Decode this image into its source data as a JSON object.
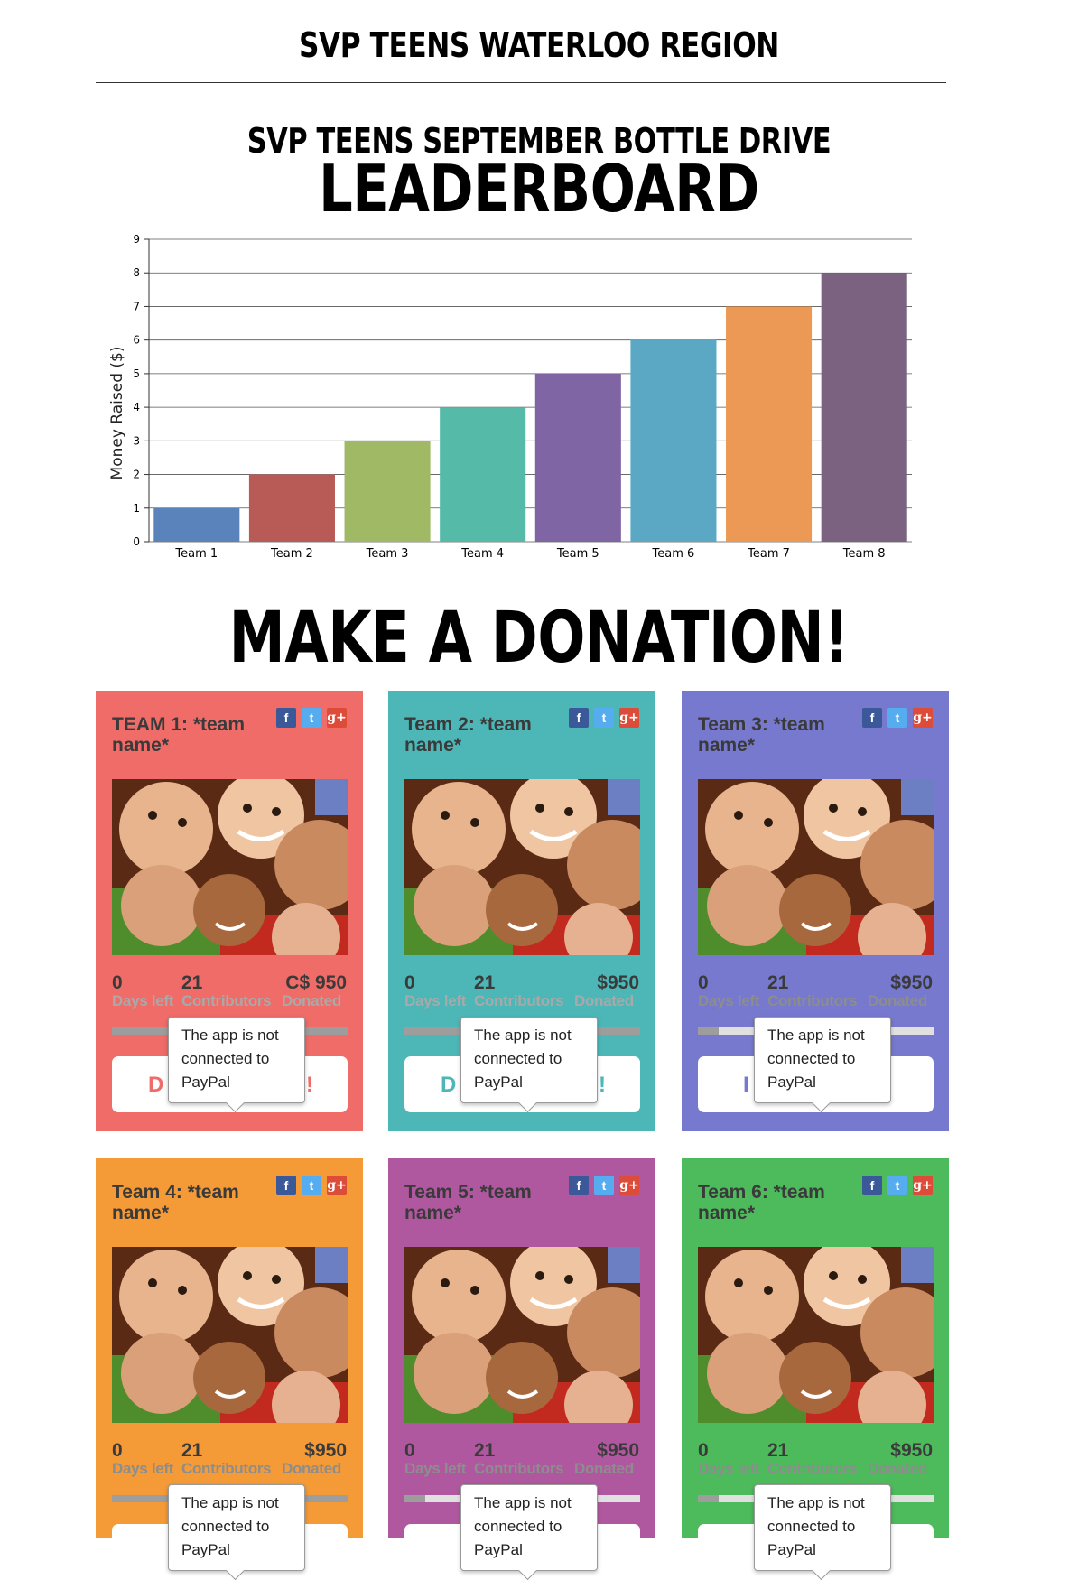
{
  "header": {
    "site_title": "SVP TEENS WATERLOO REGION"
  },
  "leaderboard": {
    "drive_title": "SVP TEENS SEPTEMBER BOTTLE DRIVE",
    "title": "LEADERBOARD"
  },
  "chart_data": {
    "type": "bar",
    "categories": [
      "Team 1",
      "Team 2",
      "Team 3",
      "Team 4",
      "Team 5",
      "Team 6",
      "Team 7",
      "Team 8"
    ],
    "values": [
      1,
      2,
      3,
      4,
      5,
      6,
      7,
      8
    ],
    "colors": [
      "#5b83bb",
      "#b85a56",
      "#a0b964",
      "#55bba8",
      "#7f65a3",
      "#5aa8c4",
      "#ec9955",
      "#7a6280"
    ],
    "ylabel": "Money Raised ($)",
    "ylim": [
      0,
      9
    ],
    "yticks": [
      0,
      1,
      2,
      3,
      4,
      5,
      6,
      7,
      8,
      9
    ],
    "grid": true
  },
  "donation": {
    "heading": "MAKE A DONATION!",
    "tooltip": "The app is not connected to PayPal",
    "share": {
      "facebook": "f",
      "twitter": "t",
      "google": "g+"
    },
    "labels": {
      "days": "Days left",
      "contributors": "Contributors",
      "donated": "Donated"
    },
    "teams": [
      {
        "title": "TEAM 1: *team name*",
        "days": "0",
        "contributors": "21",
        "donated": "C$ 950",
        "color": "#ef6c68",
        "label_color": "#a9a9a9",
        "progress": 1.0,
        "button_visible": "D",
        "button_tail": "!"
      },
      {
        "title": "Team 2: *team name*",
        "days": "0",
        "contributors": "21",
        "donated": "$950",
        "color": "#4db6b6",
        "label_color": "#a9a9a9",
        "progress": 1.0,
        "button_visible": "D",
        "button_tail": "!"
      },
      {
        "title": "Team 3: *team name*",
        "days": "0",
        "contributors": "21",
        "donated": "$950",
        "color": "#7779cf",
        "label_color": "#8d8d8d",
        "progress": 0.09,
        "button_visible": "I",
        "button_tail": ""
      },
      {
        "title": "Team 4: *team name*",
        "days": "0",
        "contributors": "21",
        "donated": "$950",
        "color": "#f49a36",
        "label_color": "#8d8d8d",
        "progress": 1.0,
        "button_visible": "",
        "button_tail": ""
      },
      {
        "title": "Team 5: *team name*",
        "days": "0",
        "contributors": "21",
        "donated": "$950",
        "color": "#b0589f",
        "label_color": "#8d8d8d",
        "progress": 0.09,
        "button_visible": "",
        "button_tail": ""
      },
      {
        "title": "Team 6: *team name*",
        "days": "0",
        "contributors": "21",
        "donated": "$950",
        "color": "#4dba5c",
        "label_color": "#8d8d8d",
        "progress": 0.09,
        "button_visible": "",
        "button_tail": ""
      }
    ]
  }
}
